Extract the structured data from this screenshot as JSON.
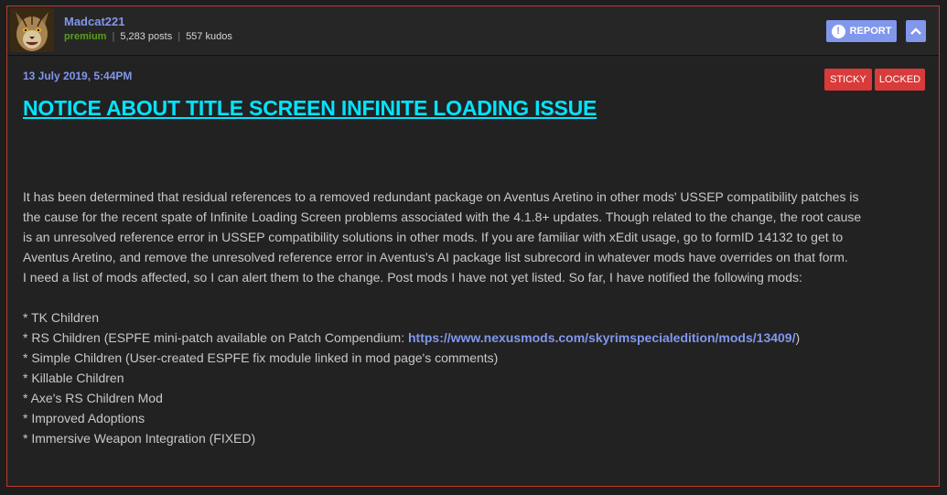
{
  "author": {
    "username": "Madcat221",
    "rank": "premium",
    "posts": "5,283 posts",
    "kudos": "557 kudos",
    "avatar_icon": "cat-avatar-icon"
  },
  "actions": {
    "report_label": "REPORT",
    "report_icon": "!",
    "up_icon": "chevron-up-icon"
  },
  "post": {
    "date": "13 July 2019, 5:44PM",
    "badges": {
      "sticky": "STICKY",
      "locked": "LOCKED"
    },
    "title": "NOTICE ABOUT TITLE SCREEN INFINITE LOADING ISSUE",
    "para1_lines": [
      "It has been determined that residual references to a removed redundant package on Aventus Aretino in other mods' USSEP compatibility patches is",
      "the cause for the recent spate of Infinite Loading Screen problems associated with the 4.1.8+ updates. Though related to the change, the root cause",
      "is an unresolved reference error in USSEP compatibility solutions in other mods. If you are familiar with xEdit usage, go to formID 14132 to get to",
      "Aventus Aretino, and remove the unresolved reference error in Aventus's AI package list subrecord in whatever mods have overrides on that form.",
      "I need a list of mods affected, so I can alert them to the change. Post mods I have not yet listed. So far, I have notified the following mods:"
    ],
    "list": {
      "tk": "* TK Children",
      "rs_prefix": "* RS Children (ESPFE mini-patch available on Patch Compendium: ",
      "rs_link": "https://www.nexusmods.com/skyrimspecialedition/mods/13409/",
      "rs_suffix": ")",
      "simple": "* Simple Children (User-created ESPFE fix module linked in mod page's comments)",
      "killable": "* Killable Children",
      "axe": "* Axe's RS Children Mod",
      "adoptions": "* Improved Adoptions",
      "immersive": "* Immersive Weapon Integration (FIXED)"
    }
  },
  "colors": {
    "accent": "#8197ec",
    "title": "#00e5ff",
    "badge": "#d93a3a",
    "border": "#c0392b",
    "rank": "#57a018"
  }
}
